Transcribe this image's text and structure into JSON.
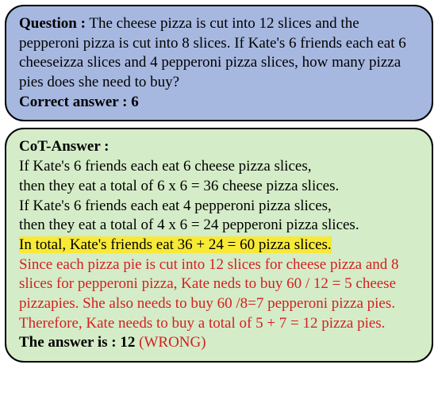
{
  "question": {
    "label": "Question :",
    "body": " The cheese pizza is cut into 12 slices and the pepperoni pizza is cut into 8 slices. If Kate's 6 friends each eat 6 cheeseizza slices and 4 pepperoni pizza slices, how many pizza pies does she need to buy?",
    "correct_label": "Correct answer :",
    "correct_value": " 6"
  },
  "cot": {
    "label": "CoT-Answer :",
    "line1": "If Kate's 6 friends each eat 6 cheese pizza slices,",
    "line2": "then they eat a total of 6 x 6 = 36 cheese pizza slices.",
    "line3": "If Kate's 6 friends each eat 4 pepperoni pizza slices,",
    "line4": "then they eat a total of 4 x 6 = 24 pepperoni pizza slices.",
    "line5": "In total, Kate's friends eat 36 + 24 = 60 pizza slices.",
    "line6": "Since each pizza pie is cut into 12 slices for cheese pizza and 8 slices for pepperoni pizza, Kate neds to buy 60 / 12 = 5 cheese pizzapies. She also needs to buy 60 /8=7 pepperoni pizza pies. Therefore, Kate needs to buy a total of 5 + 7 = 12 pizza pies.",
    "final_label": "The answer is :",
    "final_value": " 12",
    "final_status": "   (WRONG)"
  }
}
